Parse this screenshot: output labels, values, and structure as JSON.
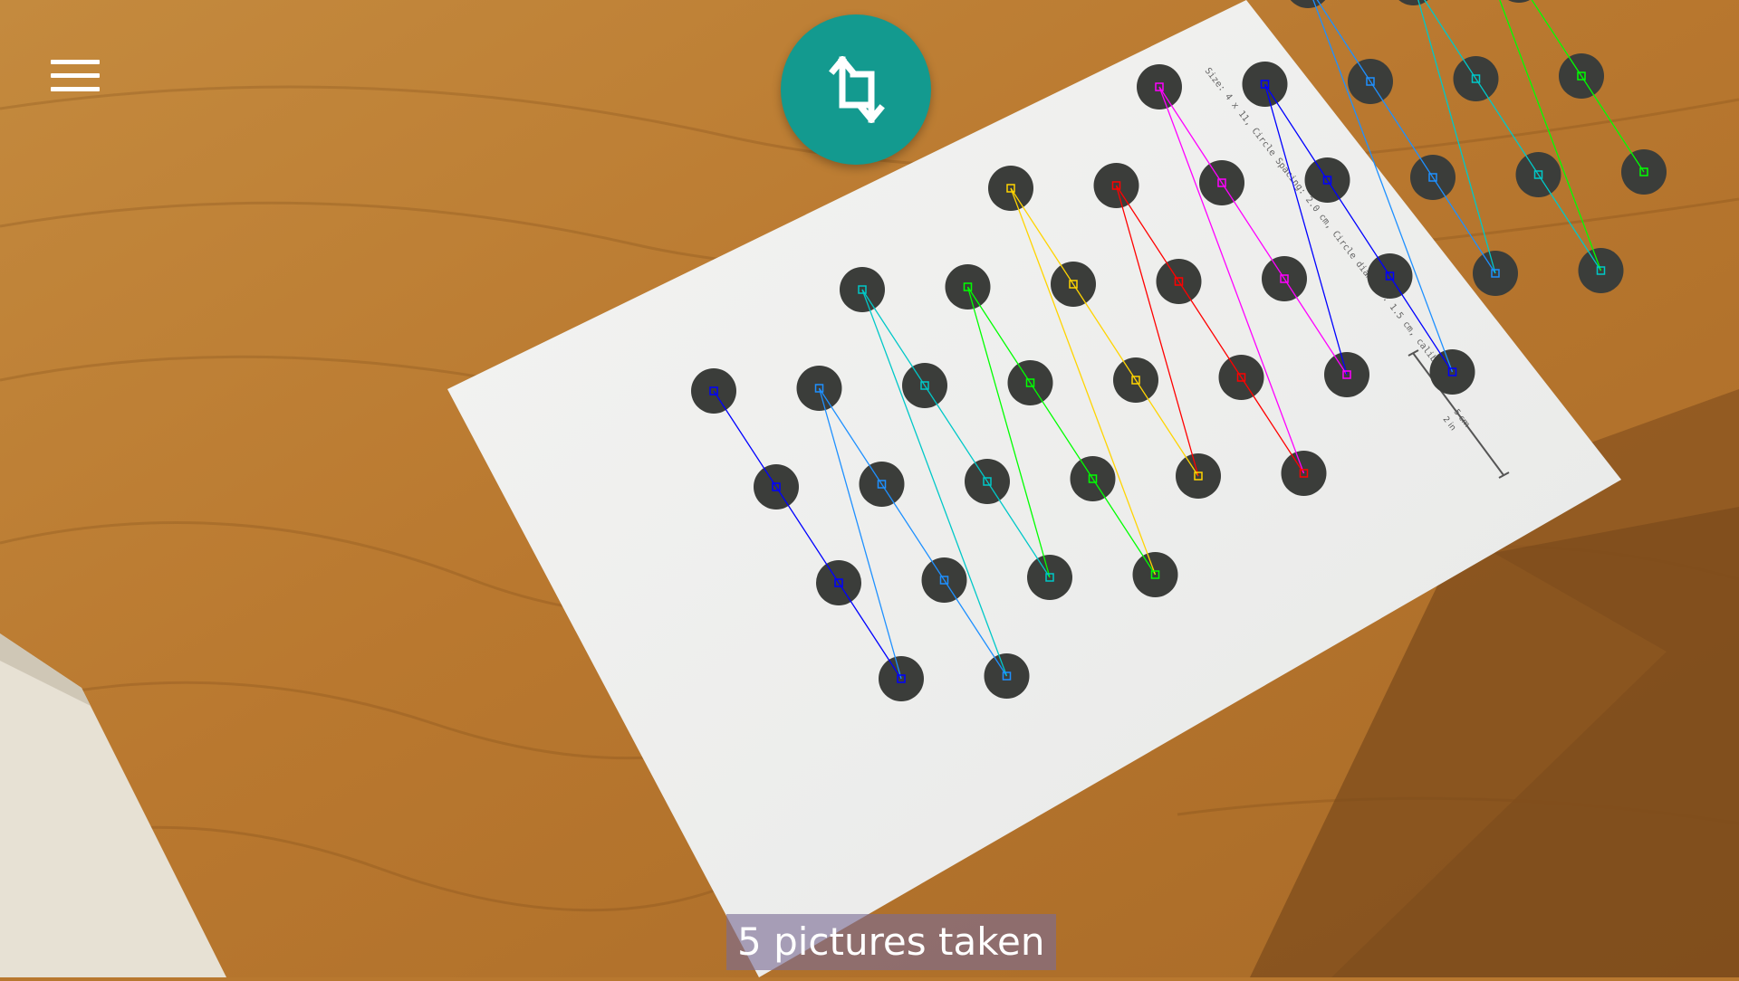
{
  "screen": {
    "status_text": "5 pictures taken"
  },
  "controls": {
    "menu_icon": "hamburger-menu-icon",
    "capture_icon": "crop-rotate-icon",
    "capture_color": "#139a8f"
  },
  "pattern": {
    "paper_text": "Size: 4 x 11, Circle Spacing: 2.0 cm, Circle diameter: 1.5 cm, calib.io",
    "scale_cm": "5 cm",
    "scale_in": "2 in",
    "rows": 4,
    "cols": 11,
    "row_colors": [
      "#0000ff",
      "#1e90ff",
      "#00c8c8",
      "#00ff00",
      "#ffd400",
      "#ff0000",
      "#ff00ff",
      "#0000ff",
      "#1e90ff",
      "#00c8c8",
      "#00ff00"
    ]
  }
}
